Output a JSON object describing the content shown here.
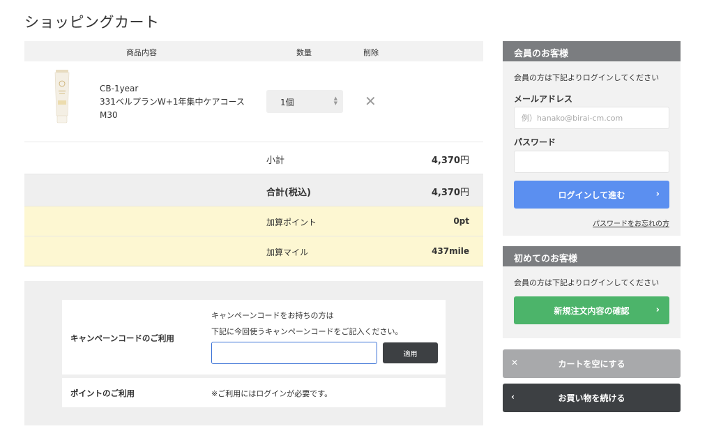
{
  "page_title": "ショッピングカート",
  "cart": {
    "headers": {
      "product": "商品内容",
      "quantity": "数量",
      "delete": "削除"
    },
    "item": {
      "code": "CB-1year",
      "name": "331ベルプランW+1年集中ケアコース",
      "size": "M30",
      "quantity": "1個"
    },
    "subtotal": {
      "label": "小計",
      "amount": "4,370",
      "unit": "円"
    },
    "total": {
      "label": "合計(税込)",
      "amount": "4,370",
      "unit": "円"
    },
    "points": {
      "label": "加算ポイント",
      "value": "0pt"
    },
    "miles": {
      "label": "加算マイル",
      "value": "437mile"
    }
  },
  "campaign": {
    "title": "キャンペーンコードのご利用",
    "desc1": "キャンペーンコードをお持ちの方は",
    "desc2": "下記に今回使うキャンペーンコードをご記入ください。",
    "input_value": "",
    "apply_label": "適用"
  },
  "point_use": {
    "title": "ポイントのご利用",
    "note": "※ご利用にはログインが必要です。"
  },
  "member": {
    "title": "会員のお客様",
    "desc": "会員の方は下記よりログインしてください",
    "email_label": "メールアドレス",
    "email_placeholder": "例）hanako@birai-cm.com",
    "password_label": "パスワード",
    "login_label": "ログインして進む",
    "forgot_label": "パスワードをお忘れの方"
  },
  "guest": {
    "title": "初めてのお客様",
    "desc": "会員の方は下記よりログインしてください",
    "confirm_label": "新規注文内容の確認"
  },
  "actions": {
    "empty_cart_label": "カートを空にする",
    "continue_label": "お買い物を続ける"
  },
  "colors": {
    "accent_blue": "#5b8ff0",
    "accent_green": "#4cb46a",
    "panel_header": "#7b7d80",
    "dark_button": "#3d4043",
    "point_row_bg": "#fdf7d2"
  }
}
